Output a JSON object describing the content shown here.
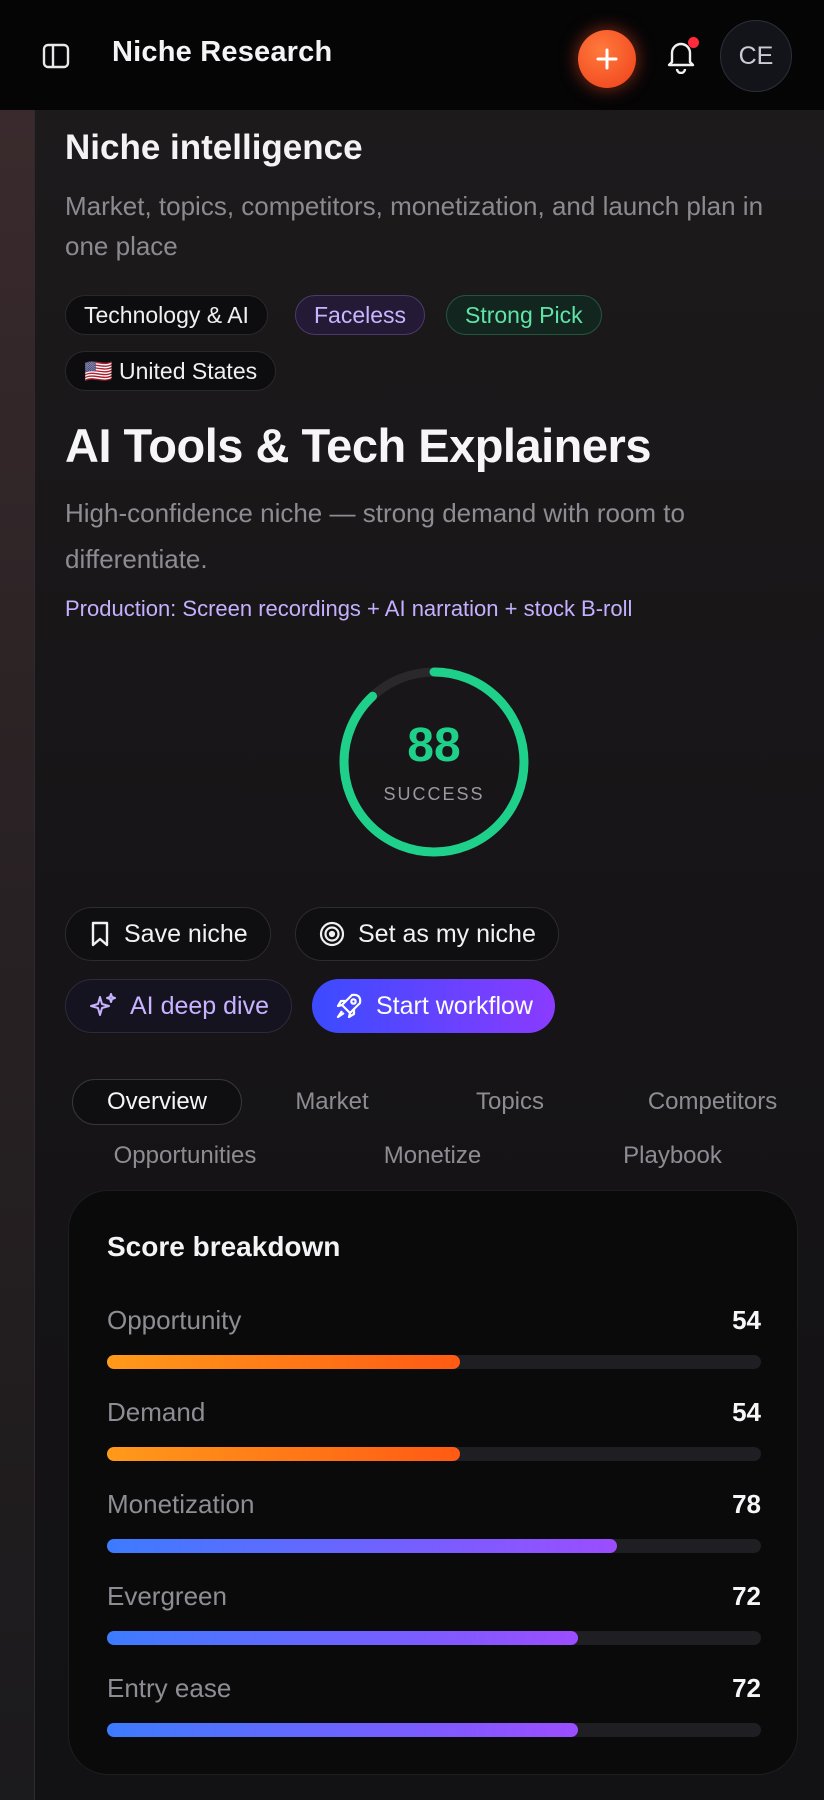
{
  "header": {
    "title": "Niche Research",
    "avatar_initials": "CE"
  },
  "intro": {
    "title": "Niche intelligence",
    "subtitle": "Market, topics, competitors, monetization, and launch plan in one place"
  },
  "tags": {
    "category": "Technology & AI",
    "style": "Faceless",
    "verdict": "Strong Pick",
    "country": "🇺🇸 United States"
  },
  "niche": {
    "title": "AI Tools & Tech Explainers",
    "description": "High-confidence niche — strong demand with room to differentiate.",
    "production": "Production: Screen recordings + AI narration + stock B-roll"
  },
  "score": {
    "value": "88",
    "label": "SUCCESS",
    "fraction": 0.88,
    "color": "#1fd08b"
  },
  "actions": {
    "save": "Save niche",
    "set": "Set as my niche",
    "deep_dive": "AI deep dive",
    "start": "Start workflow"
  },
  "tabs": [
    "Overview",
    "Market",
    "Topics",
    "Competitors",
    "Opportunities",
    "Monetize",
    "Playbook"
  ],
  "active_tab": "Overview",
  "breakdown": {
    "title": "Score breakdown",
    "metrics": [
      {
        "label": "Opportunity",
        "value": "54",
        "fraction": 0.54
      },
      {
        "label": "Demand",
        "value": "54",
        "fraction": 0.54
      },
      {
        "label": "Monetization",
        "value": "78",
        "fraction": 0.78
      },
      {
        "label": "Evergreen",
        "value": "72",
        "fraction": 0.72
      },
      {
        "label": "Entry ease",
        "value": "72",
        "fraction": 0.72
      }
    ]
  },
  "colors": {
    "accent_orange": "#ff5a14",
    "accent_purple": "#8a3bff",
    "success_green": "#1fd08b"
  }
}
